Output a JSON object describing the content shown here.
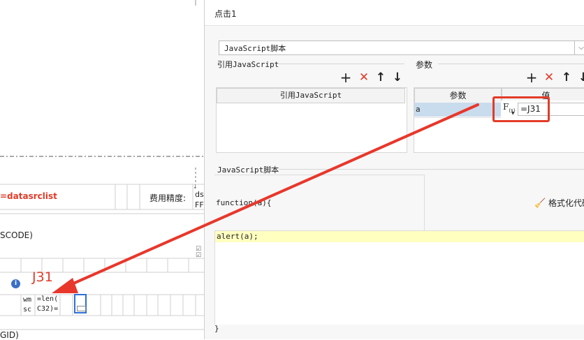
{
  "background_sheet": {
    "datasrc_formula": "=datasrclist",
    "fee_precision_label": "费用精度:",
    "fee_cut_1": "ds",
    "fee_cut_2": "FF",
    "code_fragment": "SCODE)",
    "cell_reference": "J31",
    "cell_wm": "wm",
    "cell_sc": "sc",
    "formula_line1": "=len(",
    "formula_line2": "C32)=",
    "id_fragment": "GID)",
    "colors": {
      "red": "#e23b28",
      "selection": "#2f6fd6"
    }
  },
  "dialog": {
    "title": "点击1",
    "type_select": {
      "value": "JavaScript脚本"
    },
    "ref_section": {
      "label": "引用JavaScript",
      "column_header": "引用JavaScript",
      "toolbar": {
        "add": "+",
        "delete": "✕",
        "up": "↑",
        "down": "↓"
      }
    },
    "params_section": {
      "label": "参数",
      "columns": [
        "参数",
        "值"
      ],
      "rows": [
        {
          "name": "a",
          "value": "=J31"
        }
      ],
      "formula_button": "F(x)",
      "toolbar": {
        "add": "+",
        "delete": "✕",
        "up": "↑",
        "down": "↓"
      }
    },
    "script_section": {
      "label": "JavaScript脚本",
      "function_header": "function(a){",
      "format_button": "格式化代码",
      "code": "alert(a);",
      "closing": "}"
    }
  }
}
